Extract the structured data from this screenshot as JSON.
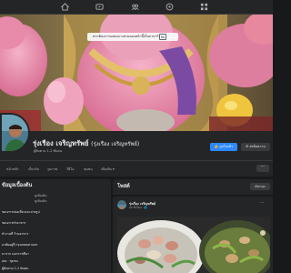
{
  "translate_bar": {
    "message": "หากต้องการแสดงบางส่วนของหน้านี้เป็นภาษาไทย",
    "toggle_label": "ปิด",
    "after_label": "เลิกทำ"
  },
  "top_nav": {
    "icons": [
      "home-icon",
      "watch-icon",
      "groups-icon",
      "gaming-icon",
      "menu-icon"
    ]
  },
  "page_header": {
    "name": "รุ่งเรือง เจริญทรัพย์",
    "name_alt": "(รุ่งเรือง เจริญทรัพย์)",
    "followers": "ผู้ติดตาม 1.2 พันคน",
    "like_button": "👍 ถูกใจแล้ว",
    "message_button": "✉ ส่งข้อความ"
  },
  "tabs": {
    "items": [
      "หน้าหลัก",
      "เกี่ยวกับ",
      "รูปภาพ",
      "วิดีโอ",
      "ชุมชน",
      "เพิ่มเติม ▾"
    ],
    "more_button": "···"
  },
  "left_intro": {
    "title": "ข้อมูลเบื้องต้น",
    "lines": [
      "ชอบการท่องเที่ยวและถ่ายรูป",
      "ชอบการทำอาหาร",
      "ทำงานที่ ร้านอาหาร",
      "อาศัยอยู่ที่ กรุงเทพมหานคร",
      "มาจาก นครราชสีมา",
      "เพจ · ชุมชน",
      "ผู้ติดตาม 1.2 พันคน"
    ],
    "sublines": [
      "ดูเพิ่มเติม",
      "ดูเพิ่มเติม"
    ]
  },
  "posts": {
    "title": "โพสต์",
    "filter_button": "ตัวกรอง",
    "post": {
      "author": "รุ่งเรือง เจริญทรัพย์",
      "time": "22 ชั่วโมง · 🌐",
      "dots": "···"
    }
  },
  "colors": {
    "accent": "#2d88ff",
    "surface": "#242526",
    "background": "#18191a"
  }
}
